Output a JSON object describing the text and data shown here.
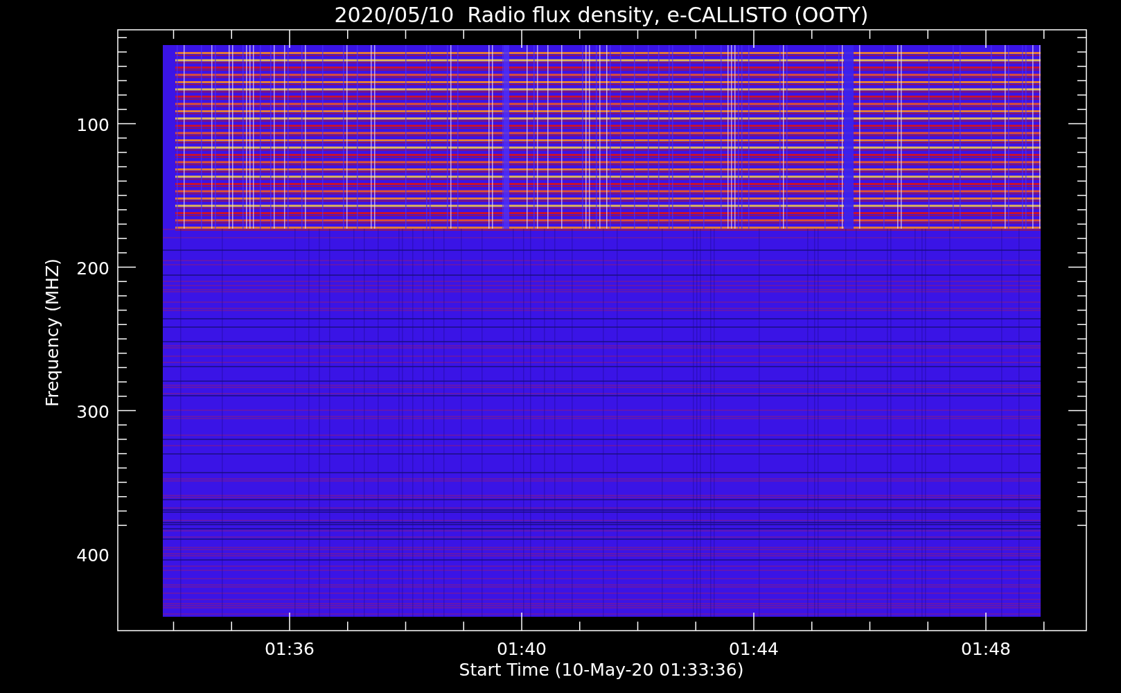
{
  "title": "2020/05/10  Radio flux density, e-CALLISTO (OOTY)",
  "y_axis": {
    "label": "Frequency (MHZ)",
    "ticks": [
      "100",
      "200",
      "300",
      "400"
    ]
  },
  "x_axis": {
    "label": "Start Time (10-May-20 01:33:36)",
    "ticks": [
      "01:36",
      "01:40",
      "01:44",
      "01:48"
    ]
  }
}
